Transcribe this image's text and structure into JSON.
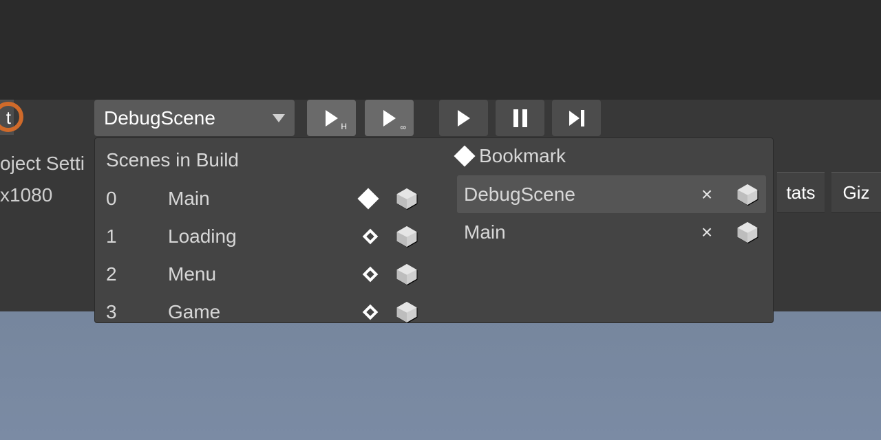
{
  "toolbar": {
    "scene_dropdown_value": "DebugScene",
    "left_truncated_button_label": "t"
  },
  "left_truncated_texts": {
    "project_settings": "oject Setti",
    "resolution": "x1080"
  },
  "right_truncated_texts": {
    "stats": "tats",
    "gizmos": "Giz"
  },
  "panel": {
    "scenes_title": "Scenes in Build",
    "scenes": [
      {
        "index": "0",
        "name": "Main",
        "bookmarked": true
      },
      {
        "index": "1",
        "name": "Loading",
        "bookmarked": false
      },
      {
        "index": "2",
        "name": "Menu",
        "bookmarked": false
      },
      {
        "index": "3",
        "name": "Game",
        "bookmarked": false
      }
    ],
    "bookmark_title": "Bookmark",
    "bookmarks": [
      {
        "name": "DebugScene",
        "selected": true
      },
      {
        "name": "Main",
        "selected": false
      }
    ]
  }
}
